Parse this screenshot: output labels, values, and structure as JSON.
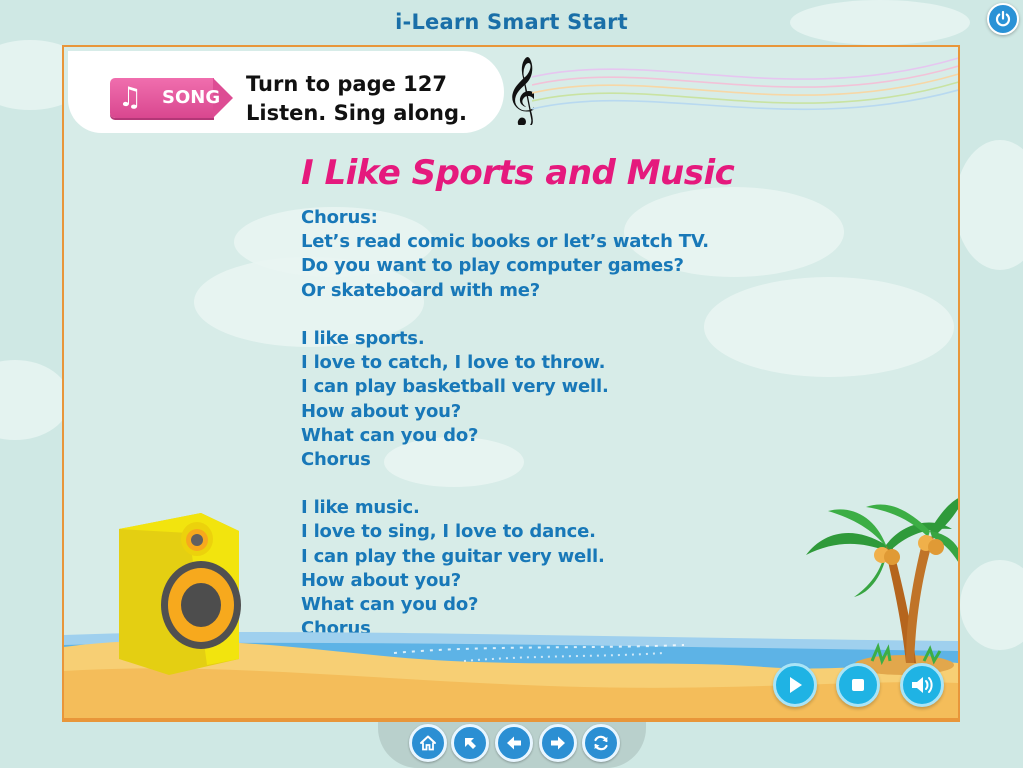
{
  "app": {
    "title": "i-Learn Smart Start",
    "power_icon": "power-icon"
  },
  "header": {
    "tag_label": "SONG",
    "tag_icon": "music-note-icon",
    "instructions": [
      "Turn to page 127",
      "Listen. Sing along."
    ],
    "clef_icon": "treble-clef-icon"
  },
  "song": {
    "title": "I Like Sports and Music",
    "lines": [
      "Chorus:",
      "Let’s read comic books or let’s watch TV.",
      "Do you want to play computer games?",
      "Or skateboard with me?",
      "",
      "I like sports.",
      "I love to catch, I love to throw.",
      "I can play basketball very well.",
      "How about you?",
      "What can you do?",
      "Chorus",
      "",
      "I like music.",
      "I love to sing, I love to dance.",
      "I can play the guitar very well.",
      "How about you?",
      "What can you do?",
      "Chorus"
    ]
  },
  "controls": [
    {
      "name": "play-button",
      "icon": "play-icon"
    },
    {
      "name": "stop-button",
      "icon": "stop-icon"
    },
    {
      "name": "volume-button",
      "icon": "speaker-volume-icon"
    }
  ],
  "navigation": [
    {
      "name": "home-button",
      "icon": "home-icon"
    },
    {
      "name": "back-to-menu-button",
      "icon": "arrow-up-left-icon"
    },
    {
      "name": "previous-button",
      "icon": "arrow-left-icon"
    },
    {
      "name": "next-button",
      "icon": "arrow-right-icon"
    },
    {
      "name": "refresh-button",
      "icon": "refresh-icon"
    }
  ],
  "colors": {
    "title_blue": "#1a6fa8",
    "song_title_pink": "#e5197d",
    "lyrics_blue": "#1878b8",
    "frame_orange": "#e8963a",
    "button_cyan": "#1fb3e4",
    "nav_blue": "#2b8fd3"
  }
}
